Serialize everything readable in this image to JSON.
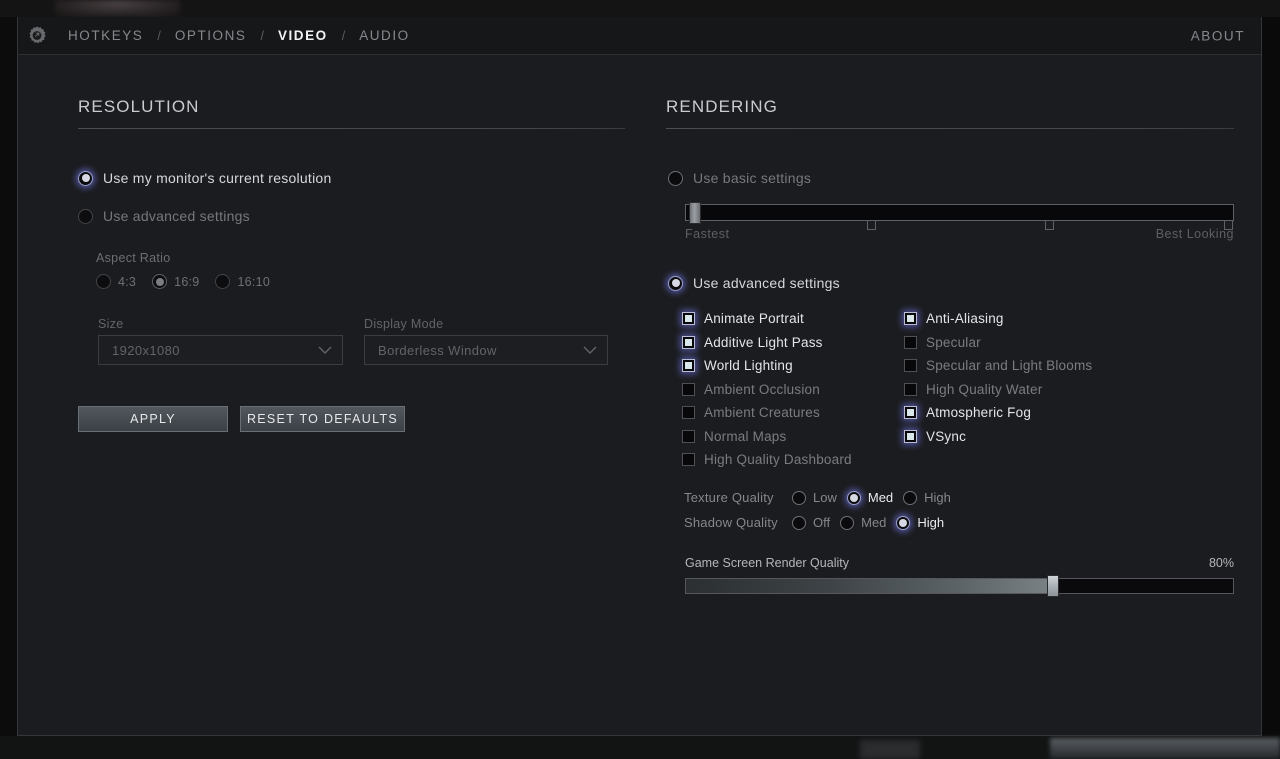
{
  "header": {
    "gear_icon": "gear-icon",
    "tabs": [
      {
        "label": "HOTKEYS",
        "active": false
      },
      {
        "label": "OPTIONS",
        "active": false
      },
      {
        "label": "VIDEO",
        "active": true
      },
      {
        "label": "AUDIO",
        "active": false
      }
    ],
    "separator": "/",
    "about_label": "ABOUT"
  },
  "resolution": {
    "section_title": "RESOLUTION",
    "use_monitor_label": "Use my monitor's current resolution",
    "use_monitor_selected": true,
    "use_advanced_label": "Use advanced settings",
    "use_advanced_selected": false,
    "aspect_ratio_label": "Aspect Ratio",
    "aspect_options": [
      {
        "label": "4:3",
        "selected": false
      },
      {
        "label": "16:9",
        "selected": true
      },
      {
        "label": "16:10",
        "selected": false
      }
    ],
    "size_label": "Size",
    "size_value": "1920x1080",
    "display_mode_label": "Display Mode",
    "display_mode_value": "Borderless Window",
    "apply_label": "APPLY",
    "reset_label": "RESET TO DEFAULTS"
  },
  "rendering": {
    "section_title": "RENDERING",
    "use_basic_label": "Use basic settings",
    "use_basic_selected": false,
    "basic_slider": {
      "min_caption": "Fastest",
      "max_caption": "Best Looking",
      "handle_percent": 1,
      "ticks_percent": [
        34,
        68,
        100
      ]
    },
    "use_advanced_label": "Use advanced settings",
    "use_advanced_selected": true,
    "checkboxes_left": [
      {
        "label": "Animate Portrait",
        "checked": true
      },
      {
        "label": "Additive Light Pass",
        "checked": true
      },
      {
        "label": "World Lighting",
        "checked": true
      },
      {
        "label": "Ambient Occlusion",
        "checked": false
      },
      {
        "label": "Ambient Creatures",
        "checked": false
      },
      {
        "label": "Normal Maps",
        "checked": false
      },
      {
        "label": "High Quality Dashboard",
        "checked": false
      }
    ],
    "checkboxes_right": [
      {
        "label": "Anti-Aliasing",
        "checked": true
      },
      {
        "label": "Specular",
        "checked": false
      },
      {
        "label": "Specular and Light Blooms",
        "checked": false
      },
      {
        "label": "High Quality Water",
        "checked": false
      },
      {
        "label": "Atmospheric Fog",
        "checked": true
      },
      {
        "label": "VSync",
        "checked": true
      }
    ],
    "texture_quality": {
      "label": "Texture Quality",
      "options": [
        {
          "label": "Low",
          "selected": false
        },
        {
          "label": "Med",
          "selected": true
        },
        {
          "label": "High",
          "selected": false
        }
      ]
    },
    "shadow_quality": {
      "label": "Shadow Quality",
      "options": [
        {
          "label": "Off",
          "selected": false
        },
        {
          "label": "Med",
          "selected": false
        },
        {
          "label": "High",
          "selected": true
        }
      ]
    },
    "render_quality": {
      "label": "Game Screen Render Quality",
      "value_text": "80%",
      "handle_percent": 67
    }
  },
  "colors": {
    "accent_glow": "#6c70d7",
    "checkbox_fill": "#d9e6ea",
    "panel_bg": "#1b1c1f",
    "tabbar_bg": "#161719"
  }
}
